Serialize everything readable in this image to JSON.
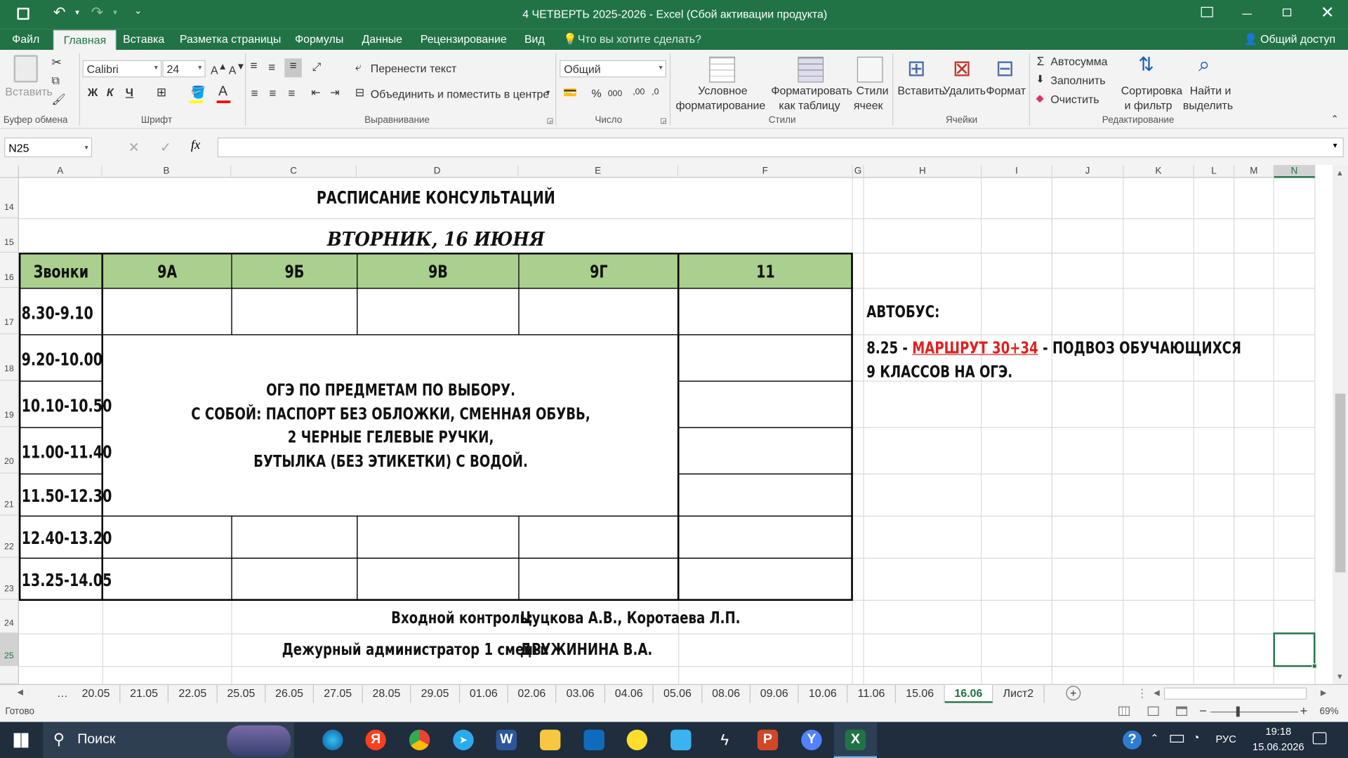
{
  "window": {
    "title": "4 ЧЕТВЕРТЬ 2025-2026 - Excel (Сбой активации продукта)"
  },
  "menu_tabs": [
    "Файл",
    "Главная",
    "Вставка",
    "Разметка страницы",
    "Формулы",
    "Данные",
    "Рецензирование",
    "Вид"
  ],
  "tell_me": "Что вы хотите сделать?",
  "share": "Общий доступ",
  "ribbon": {
    "paste": "Вставить",
    "clipboard_group": "Буфер обмена",
    "font_name": "Calibri",
    "font_size": "24",
    "font_group": "Шрифт",
    "bold": "Ж",
    "italic": "К",
    "underline": "Ч",
    "wrap_text": "Перенести текст",
    "merge_center": "Объединить и поместить в центре",
    "alignment_group": "Выравнивание",
    "number_format": "Общий",
    "number_group": "Число",
    "cond_format_1": "Условное",
    "cond_format_2": "форматирование",
    "format_table_1": "Форматировать",
    "format_table_2": "как таблицу",
    "cell_styles_1": "Стили",
    "cell_styles_2": "ячеек",
    "styles_group": "Стили",
    "insert": "Вставить",
    "delete": "Удалить",
    "format": "Формат",
    "cells_group": "Ячейки",
    "autosum": "Автосумма",
    "fill": "Заполнить",
    "clear": "Очистить",
    "sort_filter_1": "Сортировка",
    "sort_filter_2": "и фильтр",
    "find_select_1": "Найти и",
    "find_select_2": "выделить",
    "editing_group": "Редактирование"
  },
  "name_box": "N25",
  "fx": "fx",
  "columns": [
    "A",
    "B",
    "C",
    "D",
    "E",
    "F",
    "G",
    "H",
    "I",
    "J",
    "K",
    "L",
    "M",
    "N"
  ],
  "rows": [
    "14",
    "15",
    "16",
    "17",
    "18",
    "19",
    "20",
    "21",
    "22",
    "23",
    "24",
    "25"
  ],
  "sheet": {
    "title": "РАСПИСАНИЕ КОНСУЛЬТАЦИЙ",
    "date": "ВТОРНИК, 16 ИЮНЯ",
    "headers": [
      "Звонки",
      "9А",
      "9Б",
      "9В",
      "9Г",
      "11"
    ],
    "times": [
      "8.30-9.10",
      "9.20-10.00",
      "10.10-10.50",
      "11.00-11.40",
      "11.50-12.30",
      "12.40-13.20",
      "13.25-14.05"
    ],
    "note_lines": [
      "ОГЭ ПО ПРЕДМЕТАМ ПО ВЫБОРУ.",
      "С СОБОЙ: ПАСПОРТ БЕЗ ОБЛОЖКИ, СМЕННАЯ ОБУВЬ,",
      "2 ЧЕРНЫЕ ГЕЛЕВЫЕ РУЧКИ,",
      "БУТЫЛКА (БЕЗ ЭТИКЕТКИ) С ВОДОЙ."
    ],
    "entry_label": "Входной контроль:",
    "entry_value": "Цуцкова А.В., Коротаева Л.П.",
    "admin_label": "Дежурный администратор 1 смены:",
    "admin_value": "ДРУЖИНИНА В.А.",
    "bus_label": "АВТОБУС:",
    "bus_time": "8.25 - ",
    "bus_route": "МАРШРУТ 30+34",
    "bus_rest": " - ПОДВОЗ ОБУЧАЮЩИХСЯ",
    "bus_line2": "9 КЛАССОВ НА ОГЭ."
  },
  "sheet_tabs": [
    "20.05",
    "21.05",
    "22.05",
    "25.05",
    "26.05",
    "27.05",
    "28.05",
    "29.05",
    "01.06",
    "02.06",
    "03.06",
    "04.06",
    "05.06",
    "08.06",
    "09.06",
    "10.06",
    "11.06",
    "15.06",
    "16.06",
    "Лист2"
  ],
  "active_sheet": "16.06",
  "status": {
    "ready": "Готово",
    "zoom": "69%"
  },
  "taskbar": {
    "search": "Поиск",
    "lang": "РУС",
    "time": "19:18",
    "date": "15.06.2026"
  },
  "colors": {
    "excel_green": "#217346",
    "header_fill": "#a9d08e",
    "route_red": "#e02020"
  }
}
